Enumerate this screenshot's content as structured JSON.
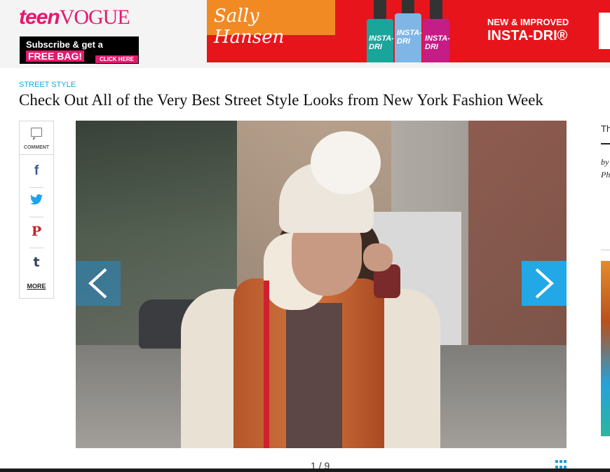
{
  "header": {
    "logo": {
      "part1": "teen",
      "part2": "VOGUE"
    },
    "subscribe": {
      "line1": "Subscribe & get a",
      "line2": "FREE BAG!",
      "cta": "CLICK HERE"
    }
  },
  "ad": {
    "brand": "Sally Hansen",
    "bottle_label": "INSTA-DRI",
    "tagline1": "NEW & IMPROVED",
    "tagline2": "INSTA-DRI®",
    "colors": {
      "bg": "#e8141c",
      "brand_bg": "#f28a24"
    }
  },
  "article": {
    "section": "STREET STYLE",
    "title": "Check Out All of the Very Best Street Style Looks from New York Fashion Week"
  },
  "share": {
    "comment_label": "COMMENT",
    "items": [
      {
        "name": "facebook",
        "glyph": "f",
        "color": "#3b5998"
      },
      {
        "name": "twitter",
        "glyph": "🐦",
        "color": "#1da1f2"
      },
      {
        "name": "pinterest",
        "glyph": "P",
        "color": "#cb2027"
      },
      {
        "name": "tumblr",
        "glyph": "t",
        "color": "#35465c"
      }
    ],
    "more_label": "MORE"
  },
  "slideshow": {
    "counter": "1 / 9",
    "accent": "#22a8e6"
  },
  "right_rail": {
    "text1": "Th",
    "text2": "by",
    "text3": "Ph"
  }
}
